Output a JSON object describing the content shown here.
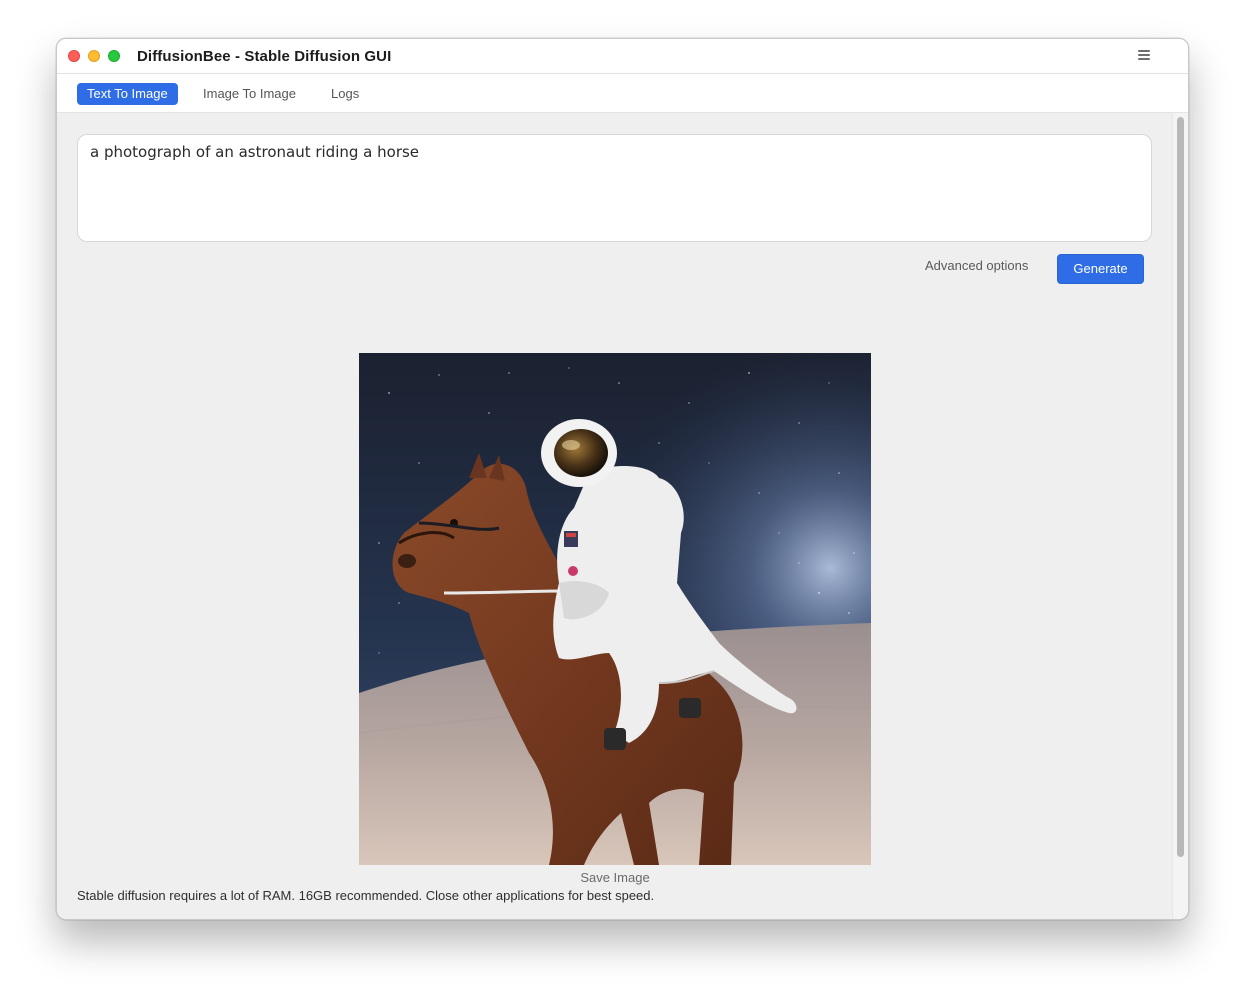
{
  "window": {
    "title": "DiffusionBee - Stable Diffusion GUI"
  },
  "tabs": [
    {
      "label": "Text To Image",
      "active": true
    },
    {
      "label": "Image To Image",
      "active": false
    },
    {
      "label": "Logs",
      "active": false
    }
  ],
  "prompt": {
    "value": "a photograph of an astronaut riding a horse"
  },
  "actions": {
    "advanced_label": "Advanced options",
    "generate_label": "Generate"
  },
  "result": {
    "save_label": "Save Image"
  },
  "footer": {
    "note": "Stable diffusion requires a lot of RAM. 16GB recommended. Close other applications for best speed."
  },
  "colors": {
    "accent": "#2f6de6",
    "background": "#efefef"
  },
  "icons": {
    "menu": "hamburger-menu-icon"
  }
}
